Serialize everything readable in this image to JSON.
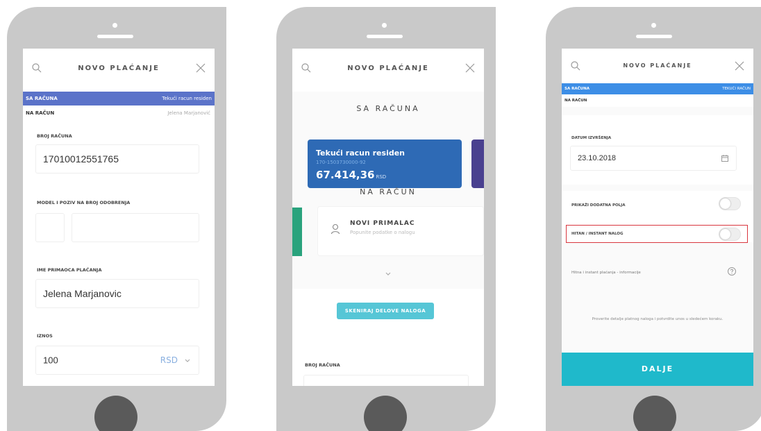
{
  "screen1": {
    "title": "NOVO PLAĆANJE",
    "from_label": "SA RAČUNA",
    "from_value": "Tekući racun residen",
    "to_label": "NA RAČUN",
    "to_value": "Jelena Marjanović",
    "account_number_label": "BROJ RAČUNA",
    "account_number_value": "17010012551765",
    "model_label": "MODEL I POZIV NA BROJ ODOBRENJA",
    "payee_label": "IME PRIMAOCA PLAĆANJA",
    "payee_value": "Jelena Marjanovic",
    "amount_label": "IZNOS",
    "amount_value": "100",
    "currency": "RSD"
  },
  "screen2": {
    "title": "NOVO PLAĆANJE",
    "from_section": "SA RAČUNA",
    "account_name": "Tekući racun residen",
    "account_number": "170-1503730000-92",
    "balance": "67.414,36",
    "balance_currency": "RSD",
    "to_section": "NA RAČUN",
    "new_recipient_title": "NOVI PRIMALAC",
    "new_recipient_subtitle": "Popunite podatke o nalogu",
    "scan_button": "SKENIRAJ DELOVE NALOGA",
    "account_number_label": "BROJ RAČUNA"
  },
  "screen3": {
    "title": "NOVO PLAĆANJE",
    "from_label": "SA RAČUNA",
    "from_value": "TEKUĆI RAČUN",
    "to_label": "NA RAČUN",
    "date_label": "DATUM IZVRŠENJA",
    "date_value": "23.10.2018",
    "extra_fields_label": "PRIKAŽI DODATNA POLJA",
    "instant_label": "HITAN / INSTANT NALOG",
    "info_text": "Hitna i instant plaćanja - informacije",
    "confirm_text": "Proverite detalje platnog naloga i potvrdite unos u sledećem koraku.",
    "next_button": "DALJE"
  },
  "colors": {
    "accent_blue": "#5b73c9",
    "card_blue": "#2e6ab5",
    "cyan": "#1fb9cb",
    "highlight_red": "#d9363e"
  }
}
